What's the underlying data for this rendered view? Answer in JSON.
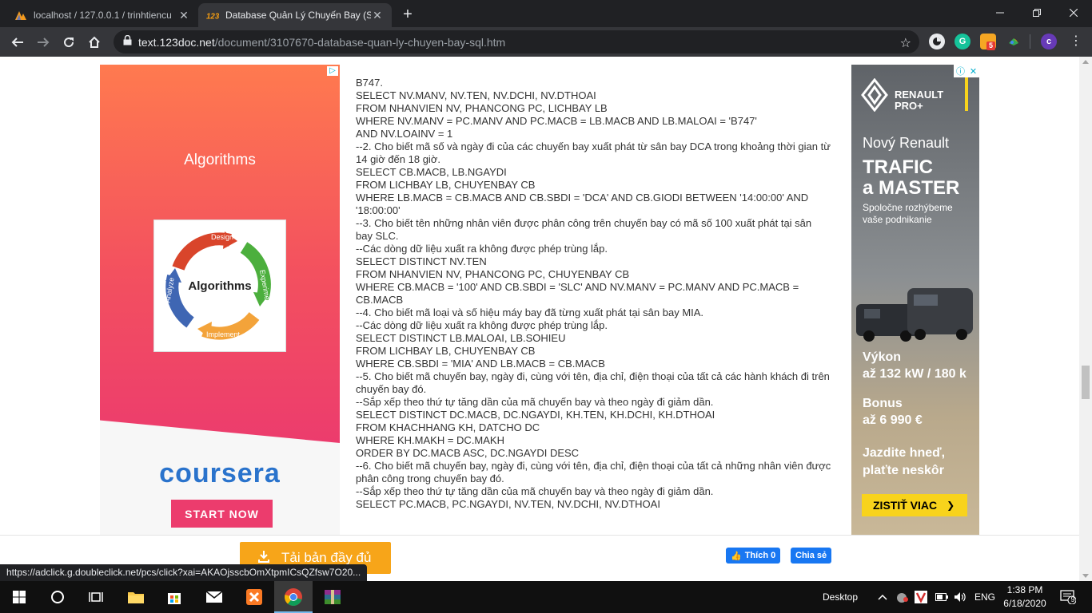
{
  "browser": {
    "tabs": [
      {
        "title": "localhost / 127.0.0.1 / trinhtiencu",
        "active": false
      },
      {
        "title": "Database Quản Lý Chuyến Bay (S",
        "active": true
      }
    ],
    "url_host": "text.123doc.net",
    "url_path": "/document/3107670-database-quan-ly-chuyen-bay-sql.htm",
    "ext_badge": "5",
    "profile_initial": "c",
    "status_url": "https://adclick.g.doubleclick.net/pcs/click?xai=AKAOjsscbOmXtpmICsQZfsw7O20..."
  },
  "left_ad": {
    "headline": "Algorithms",
    "diagram": {
      "center": "Algorithms",
      "steps": [
        "Design",
        "Experiment",
        "Implement",
        "Analyze"
      ]
    },
    "brand": "coursera",
    "cta": "START NOW"
  },
  "article": {
    "lines": [
      "B747.",
      "SELECT NV.MANV, NV.TEN, NV.DCHI, NV.DTHOAI",
      "FROM NHANVIEN NV, PHANCONG PC, LICHBAY LB",
      "WHERE NV.MANV = PC.MANV AND PC.MACB = LB.MACB AND LB.MALOAI = 'B747'",
      "AND NV.LOAINV = 1",
      "--2. Cho biết mã số và ngày đi của các chuyến bay xuất phát từ sân bay DCA trong khoảng thời gian từ 14 giờ đến 18 giờ.",
      "SELECT CB.MACB, LB.NGAYDI",
      "FROM LICHBAY LB, CHUYENBAY CB",
      "WHERE LB.MACB = CB.MACB AND CB.SBDI = 'DCA' AND CB.GIODI BETWEEN '14:00:00' AND '18:00:00'",
      "--3. Cho biết tên những nhân viên được phân công trên chuyến bay có mã số 100 xuất phát tại sân",
      "bay SLC.",
      "--Các dòng dữ liệu xuất ra không được phép trùng lắp.",
      "SELECT DISTINCT NV.TEN",
      "FROM NHANVIEN NV, PHANCONG PC, CHUYENBAY CB",
      "WHERE CB.MACB = '100' AND CB.SBDI = 'SLC' AND NV.MANV = PC.MANV AND PC.MACB = CB.MACB",
      "--4. Cho biết mã loại và số hiệu máy bay đã từng xuất phát tại sân bay MIA.",
      "--Các dòng dữ liệu xuất ra không được phép trùng lắp.",
      "SELECT DISTINCT LB.MALOAI, LB.SOHIEU",
      "FROM LICHBAY LB, CHUYENBAY CB",
      "WHERE CB.SBDI = 'MIA' AND LB.MACB = CB.MACB",
      "--5. Cho biết mã chuyến bay, ngày đi, cùng với tên, địa chỉ, điện thoại của tất cả các hành khách đi trên chuyến bay đó.",
      "--Sắp xếp theo thứ tự tăng dần của mã chuyến bay và theo ngày đi giảm dần.",
      "SELECT DISTINCT DC.MACB, DC.NGAYDI, KH.TEN, KH.DCHI, KH.DTHOAI",
      "FROM KHACHHANG KH, DATCHO DC",
      "WHERE KH.MAKH = DC.MAKH",
      "ORDER BY DC.MACB ASC, DC.NGAYDI DESC",
      "--6. Cho biết mã chuyến bay, ngày đi, cùng với tên, địa chỉ, điện thoại của tất cả những nhân viên được phân công trong chuyến bay đó.",
      "--Sắp xếp theo thứ tự tăng dần của mã chuyến bay và theo ngày đi giảm dần.",
      "SELECT PC.MACB, PC.NGAYDI, NV.TEN, NV.DCHI, NV.DTHOAI"
    ]
  },
  "right_ad": {
    "brand_line1": "RENAULT",
    "brand_line2": "PRO+",
    "line1": "Nový Renault",
    "line2": "TRAFIC",
    "line3": "a MASTER",
    "sub": "Spoločne rozhýbeme vaše podnikanie",
    "spec1_label": "Výkon",
    "spec1_value": "až 132 kW / 180 k",
    "spec2_label": "Bonus",
    "spec2_value": "až 6 990 €",
    "tagline": "Jazdite hneď, plaťte neskôr",
    "cta": "ZISTIŤ VIAC"
  },
  "actions": {
    "download": "Tải bản đầy đủ",
    "fb_like": "Thích 0",
    "fb_share": "Chia sẻ"
  },
  "taskbar": {
    "desktop_label": "Desktop",
    "lang": "ENG",
    "time": "1:38 PM",
    "date": "6/18/2020",
    "notif_count": "9"
  }
}
